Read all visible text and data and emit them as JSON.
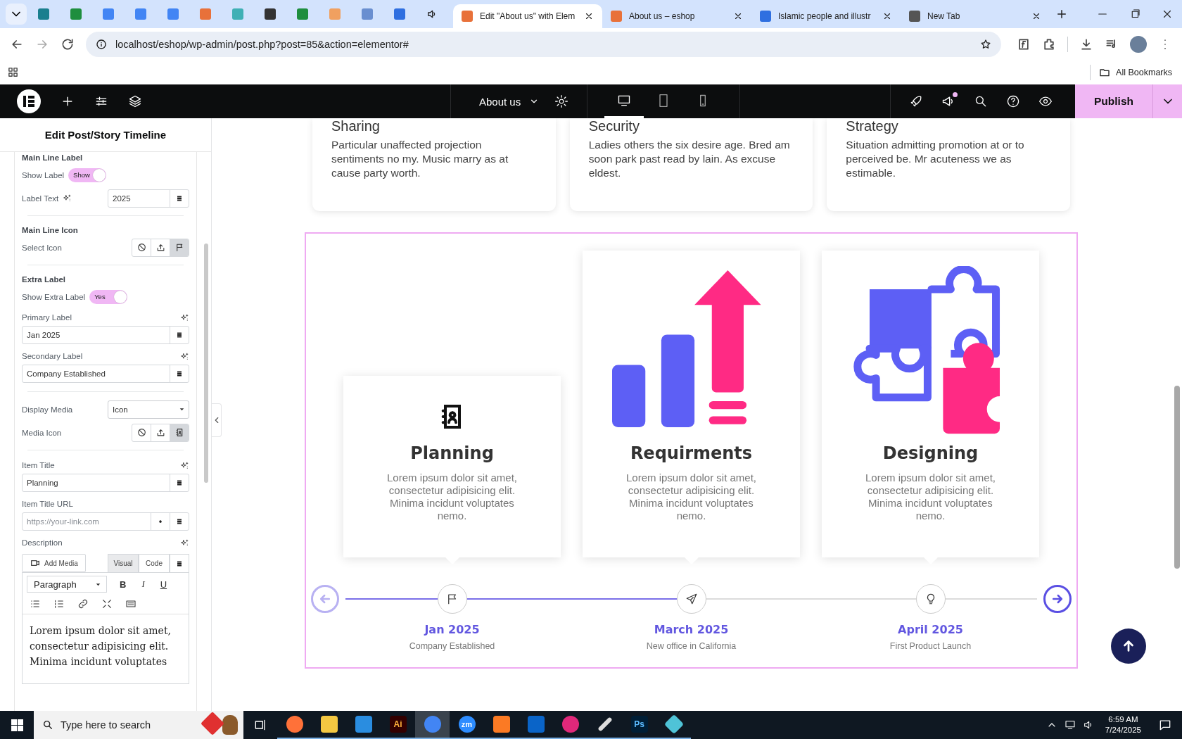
{
  "browser": {
    "tabs": [
      {
        "title": "Edit \"About us\" with Elem",
        "selected": true
      },
      {
        "title": "About us – eshop",
        "selected": false
      },
      {
        "title": "Islamic people and illustr",
        "selected": false
      },
      {
        "title": "New Tab",
        "selected": false
      }
    ],
    "address": "localhost/eshop/wp-admin/post.php?post=85&action=elementor#",
    "bookmarks_label": "All Bookmarks"
  },
  "editor": {
    "page_title": "About us",
    "devices": [
      {
        "kind": "desktop",
        "selected": true
      },
      {
        "kind": "tablet",
        "selected": false
      },
      {
        "kind": "mobile",
        "selected": false
      }
    ],
    "notification": true,
    "publish": "Publish"
  },
  "panel": {
    "title": "Edit Post/Story Timeline",
    "controls": [
      {
        "kind": "heading",
        "label": "Main Line Label"
      },
      {
        "kind": "switch",
        "label": "Show Label",
        "on": true,
        "text": "Show"
      },
      {
        "kind": "inline_input",
        "label": "Label Text",
        "value": "2025"
      },
      {
        "kind": "divider"
      },
      {
        "kind": "heading",
        "label": "Main Line Icon"
      },
      {
        "kind": "icon_choice",
        "label": "Select Icon",
        "options": [
          {
            "kind": "none",
            "selected": false
          },
          {
            "kind": "upload",
            "selected": false
          },
          {
            "kind": "flag",
            "selected": true
          }
        ]
      },
      {
        "kind": "divider"
      },
      {
        "kind": "heading",
        "label": "Extra Label"
      },
      {
        "kind": "switch",
        "label": "Show Extra Label",
        "on": true,
        "text": "Yes"
      },
      {
        "kind": "field",
        "label": "Primary Label",
        "value": "Jan 2025"
      },
      {
        "kind": "field",
        "label": "Secondary Label",
        "value": "Company Established"
      },
      {
        "kind": "divider"
      },
      {
        "kind": "select",
        "label": "Display Media",
        "value": "Icon"
      },
      {
        "kind": "icon_choice",
        "label": "Media Icon",
        "options": [
          {
            "kind": "none",
            "selected": false
          },
          {
            "kind": "upload",
            "selected": false
          },
          {
            "kind": "contact",
            "selected": true
          }
        ]
      },
      {
        "kind": "divider"
      },
      {
        "kind": "field",
        "label": "Item Title",
        "value": "Planning"
      },
      {
        "kind": "url",
        "label": "Item Title URL",
        "placeholder": "https://your-link.com"
      },
      {
        "kind": "editor",
        "label": "Description",
        "add_media": "Add Media",
        "tabs": [
          {
            "label": "Visual",
            "selected": true
          },
          {
            "label": "Code",
            "selected": false
          }
        ],
        "format": "Paragraph",
        "format_buttons": [
          "B",
          "I",
          "U"
        ],
        "content": "Lorem ipsum dolor sit amet, consectetur adipisicing elit. Minima incidunt voluptates"
      }
    ]
  },
  "top_cards": [
    {
      "title": "Sharing",
      "text": "Particular unaffected projection sentiments no my. Music marry as at cause party worth."
    },
    {
      "title": "Security",
      "text": "Ladies others the six desire age. Bred am soon park past read by lain. As excuse eldest."
    },
    {
      "title": "Strategy",
      "text": "Situation admitting promotion at or to perceived be. Mr acuteness we as estimable."
    }
  ],
  "timeline": {
    "progress": {
      "level": 0.48
    },
    "prev_disabled": true,
    "next_disabled": false,
    "items": [
      {
        "kind": "icon",
        "title": "Planning",
        "description": "Lorem ipsum dolor sit amet, consectetur adipisicing elit. Minima incidunt voluptates nemo.",
        "date": "Jan 2025",
        "caption": "Company Established"
      },
      {
        "kind": "growth",
        "title": "Requirments",
        "description": "Lorem ipsum dolor sit amet, consectetur adipisicing elit. Minima incidunt voluptates nemo.",
        "date": "March 2025",
        "caption": "New office in California"
      },
      {
        "kind": "puzzle",
        "title": "Designing",
        "description": "Lorem ipsum dolor sit amet, consectetur adipisicing elit. Minima incidunt voluptates nemo.",
        "date": "April 2025",
        "caption": "First Product Launch"
      }
    ]
  },
  "taskbar": {
    "search_placeholder": "Type here to search",
    "apps": [
      {
        "selected": false
      },
      {
        "selected": false
      },
      {
        "selected": false
      },
      {
        "label": "Ai",
        "selected": false
      },
      {
        "selected": true
      },
      {
        "label": "zm",
        "selected": false
      },
      {
        "selected": false
      },
      {
        "selected": false
      },
      {
        "selected": false
      },
      {
        "selected": false
      },
      {
        "label": "Ps",
        "selected": false
      },
      {
        "selected": false
      }
    ],
    "time": "6:59 AM",
    "date": "7/24/2025"
  }
}
